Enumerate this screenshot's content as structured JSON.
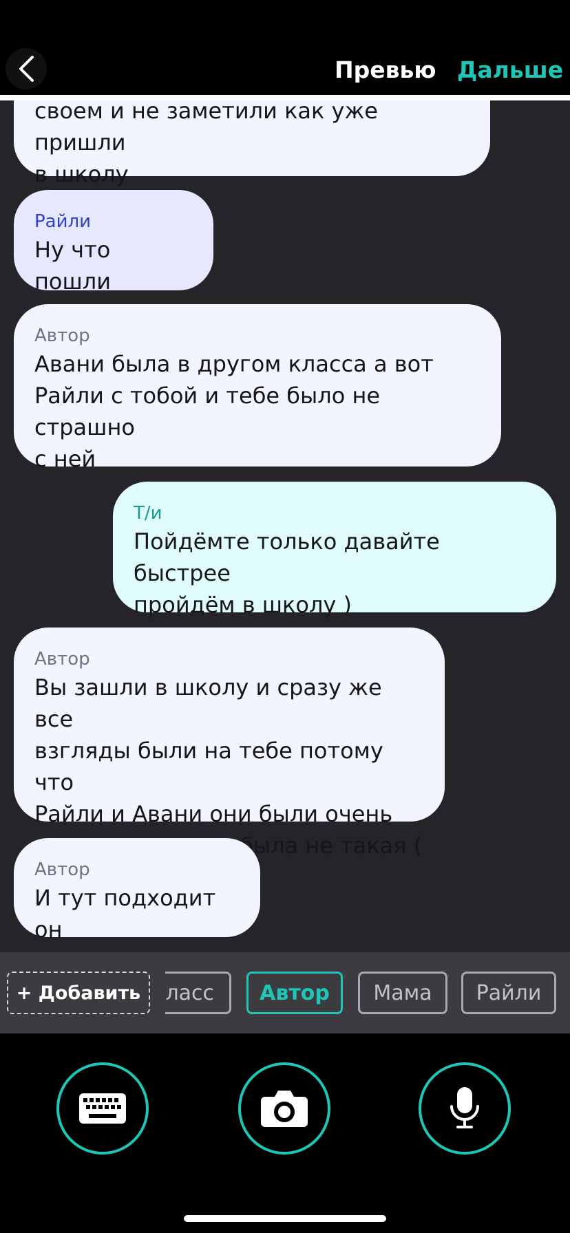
{
  "header": {
    "preview_label": "Превью",
    "next_label": "Дальше"
  },
  "messages": [
    {
      "sender": "",
      "text": "своем и не заметили как уже пришли\nв школу",
      "style": "author"
    },
    {
      "sender": "Райли",
      "text": "Ну что пошли",
      "style": "raily"
    },
    {
      "sender": "Автор",
      "text": "Авани была в другом класса а вот\nРайли с тобой и тебе было не страшно\nс ней",
      "style": "author"
    },
    {
      "sender": "Т/и",
      "text": "Пойдёмте только давайте быстрее\nпройдём в школу )",
      "style": "ti"
    },
    {
      "sender": "Автор",
      "text": "Вы зашли в школу и сразу же все\nвзгляды были на тебе потому что\nРайли и Авани они были очень\nкрасивые а я вот была не такая (",
      "style": "author"
    },
    {
      "sender": "Автор",
      "text": "И тут подходит он",
      "style": "author"
    }
  ],
  "character_bar": {
    "add_label": "+ Добавить",
    "chips": [
      {
        "label": "Класс",
        "active": false
      },
      {
        "label": "Автор",
        "active": true
      },
      {
        "label": "Мама",
        "active": false
      },
      {
        "label": "Райли",
        "active": false
      }
    ]
  },
  "toolbar": {
    "icons": [
      "keyboard-icon",
      "camera-icon",
      "microphone-icon"
    ],
    "accent_color": "#1fc5b6"
  }
}
